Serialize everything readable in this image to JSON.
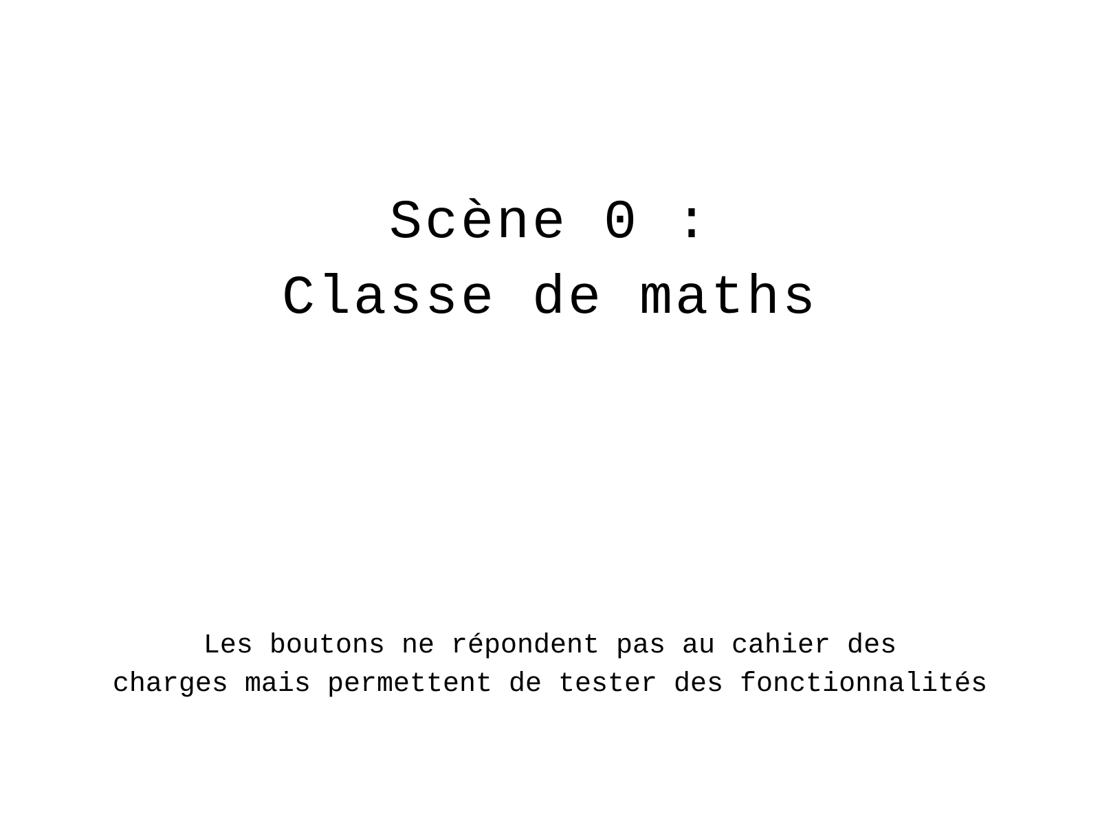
{
  "scene": {
    "title_line1": "Scène 0 :",
    "title_line2": "Classe de maths",
    "note_line1": "Les boutons ne répondent pas au cahier des",
    "note_line2": "charges mais permettent de tester des fonctionnalités"
  }
}
